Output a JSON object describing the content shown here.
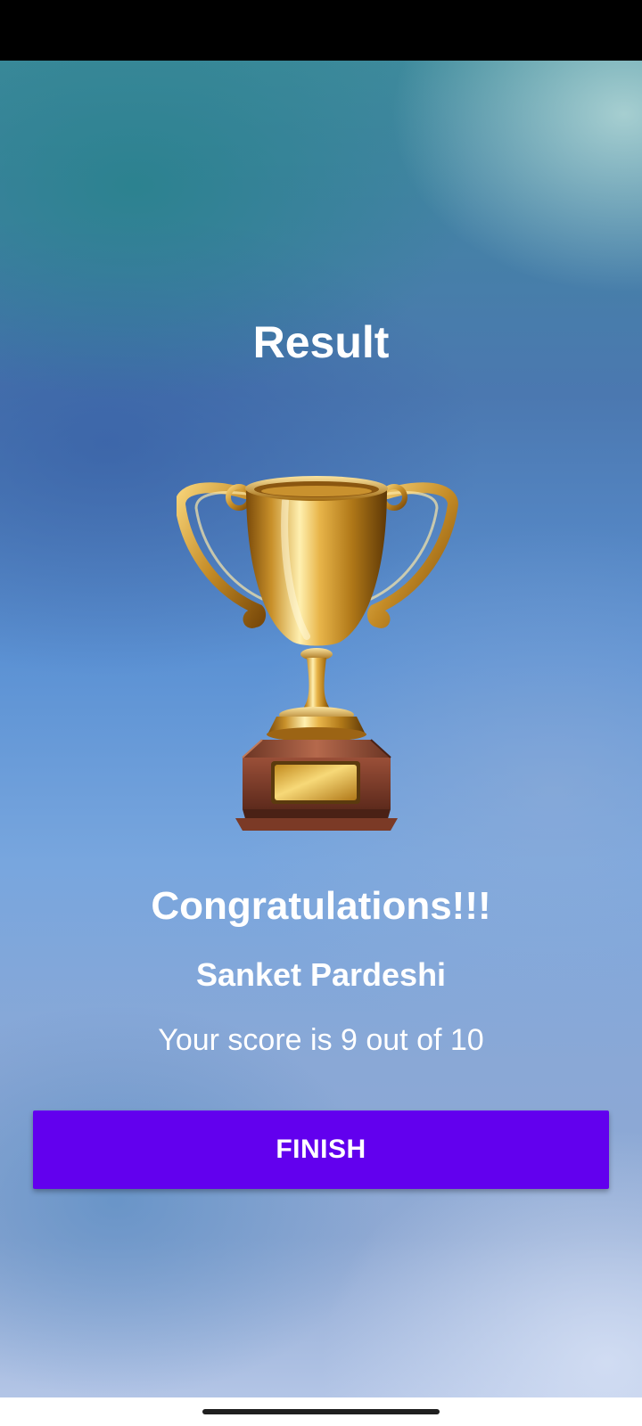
{
  "result_screen": {
    "title": "Result",
    "trophy_image": "trophy-icon",
    "congrats_text": "Congratulations!!!",
    "player_name": "Sanket Pardeshi",
    "score_text": "Your score is 9 out of 10",
    "finish_label": "FINISH"
  },
  "colors": {
    "primary_button": "#6200ee",
    "text": "#ffffff"
  }
}
